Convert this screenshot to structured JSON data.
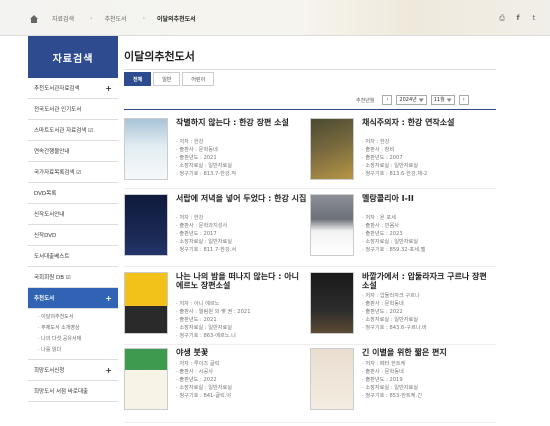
{
  "breadcrumb": {
    "items": [
      "자료검색",
      "추천도서",
      "이달의추천도서"
    ]
  },
  "sidebar": {
    "heading": "자료검색",
    "items": [
      {
        "label": "추천도서관자료검색",
        "plus": "+"
      },
      {
        "label": "전국도서관 인기도서",
        "plus": ""
      },
      {
        "label": "스마트도서관 자료검색 ☑",
        "plus": ""
      },
      {
        "label": "연속간행물안내",
        "plus": ""
      },
      {
        "label": "국가자료목록검색 ☑",
        "plus": ""
      },
      {
        "label": "DVD목록",
        "plus": ""
      },
      {
        "label": "신작도서안내",
        "plus": ""
      },
      {
        "label": "신작DVD",
        "plus": ""
      },
      {
        "label": "도서대출베스트",
        "plus": ""
      },
      {
        "label": "국회회원 DB ☑",
        "plus": ""
      }
    ],
    "active": {
      "label": "추천도서",
      "plus": "+"
    },
    "sub": [
      "· 이달의추천도서",
      "· 주제도서 소개영상",
      "· 나의 다섯 공유서재",
      "· 나를 읽다"
    ],
    "after": [
      {
        "label": "희망도서신청",
        "plus": "+"
      },
      {
        "label": "희망도서 서점 바로대출",
        "plus": ""
      }
    ]
  },
  "main": {
    "title": "이달의추천도서",
    "tabs": [
      "전체",
      "일반",
      "어린이"
    ],
    "filter_label": "추천년월",
    "year": "2024년",
    "month": "11월",
    "prev": "‹",
    "next": "›"
  },
  "books": [
    {
      "title": "작별하지 않는다 : 한강 장편 소설",
      "meta": [
        "저자 : 한강",
        "출판사 : 문학동네",
        "출판년도 : 2021",
        "소장자료실 : 일반자료실",
        "청구기호 : 813.7-한강.작"
      ]
    },
    {
      "title": "채식주의자 : 한강 연작소설",
      "meta": [
        "저자 : 한강",
        "출판사 : 창비",
        "출판년도 : 2007",
        "소장자료실 : 일반자료실",
        "청구기호 : 813.6-한강.채-2"
      ]
    },
    {
      "title": "서랍에 저녁을 넣어 두었다 : 한강 시집",
      "meta": [
        "저자 : 한강",
        "출판사 : 문학과지성사",
        "출판년도 : 2017",
        "소장자료실 : 일반자료실",
        "청구기호 : 811.7-한강.서"
      ]
    },
    {
      "title": "멜랑콜리아 I-II",
      "meta": [
        "저자 : 욘 포세",
        "출판사 : 민음사",
        "출판년도 : 2023",
        "소장자료실 : 일반자료실",
        "청구기호 : 859.32-포세.멜"
      ]
    },
    {
      "title": "나는 나의 밤을 떠나지 않는다 : 아니 에르노 장편소설",
      "meta": [
        "저자 : 아니 에르노",
        "출판사 : 열림원 외 몇 권 : 2021",
        "출판년도 : 2021",
        "소장자료실 : 일반자료실",
        "청구기호 : 863-에르노.나"
      ]
    },
    {
      "title": "바깥가에서 : 압둘라자크 구르나 장편소설",
      "meta": [
        "저자 : 압둘라자크 구르나",
        "출판사 : 문학동네",
        "출판년도 : 2022",
        "소장자료실 : 일반자료실",
        "청구기호 : 843.6-구르나.바"
      ]
    },
    {
      "title": "야생 붓꽃",
      "meta": [
        "저자 : 루이즈 글릭",
        "출판사 : 시공사",
        "출판년도 : 2022",
        "소장자료실 : 일반자료실",
        "청구기호 : 841-글릭.야"
      ]
    },
    {
      "title": "긴 이별을 위한 짧은 편지",
      "meta": [
        "저자 : 페터 한트케",
        "출판사 : 문학동네",
        "출판년도 : 2019",
        "소장자료실 : 일반자료실",
        "청구기호 : 853-한트케.긴"
      ]
    }
  ],
  "colors": {
    "accent": "#2d4b8e",
    "active": "#3063b4"
  }
}
